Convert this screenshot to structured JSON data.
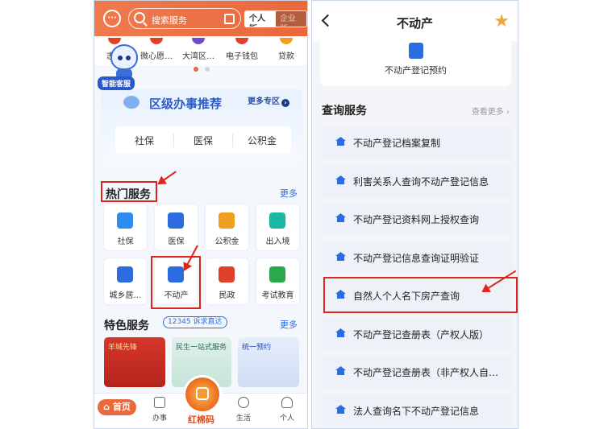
{
  "left": {
    "header": {
      "search_placeholder": "搜索服务",
      "version_personal": "个人版",
      "version_business": "企业版"
    },
    "quick_items": [
      "志…",
      "微心愿…",
      "大湾区…",
      "电子钱包",
      "贷款"
    ],
    "assistant_tag": "智能客服",
    "banner": {
      "title": "区级办事推荐",
      "more": "更多专区",
      "tabs": [
        "社保",
        "医保",
        "公积金"
      ]
    },
    "hot": {
      "title": "热门服务",
      "more": "更多",
      "items": [
        {
          "label": "社保",
          "icon": "shield-icon",
          "color": "#2d8cf0"
        },
        {
          "label": "医保",
          "icon": "card-icon",
          "color": "#2d6cdf"
        },
        {
          "label": "公积金",
          "icon": "house-coin-icon",
          "color": "#f0a020"
        },
        {
          "label": "出入境",
          "icon": "passport-icon",
          "color": "#19b8a0"
        },
        {
          "label": "城乡居…",
          "icon": "house-icon",
          "color": "#2d6cdf"
        },
        {
          "label": "不动产",
          "icon": "house-key-icon",
          "color": "#2d6cdf"
        },
        {
          "label": "民政",
          "icon": "people-icon",
          "color": "#e0402a"
        },
        {
          "label": "考试教育",
          "icon": "graduation-cap-icon",
          "color": "#2aa84a"
        }
      ]
    },
    "featured": {
      "title": "特色服务",
      "pill": "12345 诉求直达",
      "more": "更多",
      "cards": [
        "羊城先锋",
        "民生一站式服务",
        "统一预约"
      ]
    },
    "nav": {
      "home": "首页",
      "work": "办事",
      "center": "红棉码",
      "life": "生活",
      "me": "个人"
    }
  },
  "right": {
    "title": "不动产",
    "top_service": "不动产登记预约",
    "query": {
      "title": "查询服务",
      "more": "查看更多",
      "items": [
        "不动产登记档案复制",
        "利害关系人查询不动产登记信息",
        "不动产登记资料网上授权查询",
        "不动产登记信息查询证明验证",
        "自然人个人名下房产查询",
        "不动产登记查册表（产权人版）",
        "不动产登记查册表（非产权人自…",
        "法人查询名下不动产登记信息"
      ]
    }
  },
  "colors": {
    "accent_orange": "#e9683c",
    "accent_blue": "#2d6cdf",
    "highlight_red": "#e0231b"
  }
}
